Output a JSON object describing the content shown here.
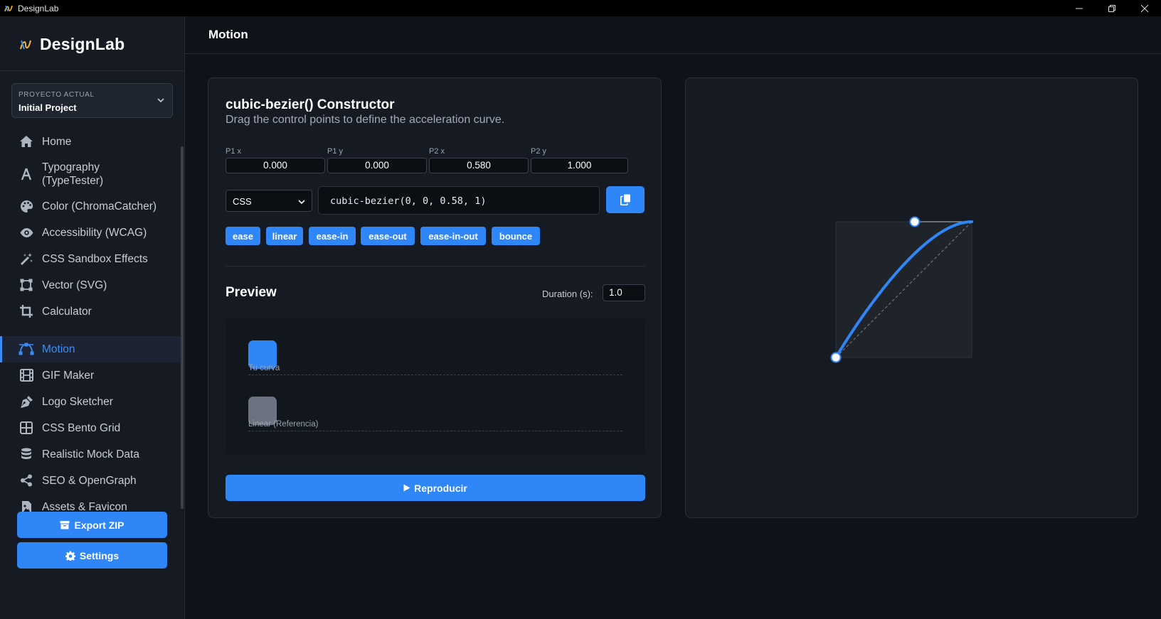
{
  "window": {
    "title": "DesignLab",
    "controls": [
      "minimize-icon",
      "restore-icon",
      "close-icon"
    ]
  },
  "sidebar": {
    "brand": "DesignLab",
    "project": {
      "label": "PROYECTO ACTUAL",
      "value": "Initial Project"
    },
    "items": [
      {
        "label": "Home",
        "icon": "home-icon"
      },
      {
        "label": "Typography\n(TypeTester)",
        "icon": "typography-icon"
      },
      {
        "label": "Color (ChromaCatcher)",
        "icon": "palette-icon"
      },
      {
        "label": "Accessibility (WCAG)",
        "icon": "eye-icon"
      },
      {
        "label": "CSS Sandbox Effects",
        "icon": "magic-wand-icon"
      },
      {
        "label": "Vector (SVG)",
        "icon": "vector-square-icon"
      },
      {
        "label": "Calculator",
        "icon": "crop-icon"
      },
      {
        "label": "Motion",
        "icon": "bezier-curve-icon",
        "active": true
      },
      {
        "label": "GIF Maker",
        "icon": "film-icon"
      },
      {
        "label": "Logo Sketcher",
        "icon": "pen-nib-icon"
      },
      {
        "label": "CSS Bento Grid",
        "icon": "grid-icon"
      },
      {
        "label": "Realistic Mock Data",
        "icon": "database-icon"
      },
      {
        "label": "SEO & OpenGraph",
        "icon": "share-icon"
      },
      {
        "label": "Assets & Favicon",
        "icon": "file-image-icon"
      }
    ],
    "export_label": "Export ZIP",
    "settings_label": "Settings"
  },
  "header": {
    "title": "Motion"
  },
  "constructor": {
    "title": "cubic-bezier() Constructor",
    "subtitle": "Drag the control points to define the acceleration curve.",
    "coords": [
      {
        "label": "P1 x",
        "value": "0.000"
      },
      {
        "label": "P1 y",
        "value": "0.000"
      },
      {
        "label": "P2 x",
        "value": "0.580"
      },
      {
        "label": "P2 y",
        "value": "1.000"
      }
    ],
    "format": {
      "selected": "CSS"
    },
    "code": "cubic-bezier(0, 0, 0.58, 1)",
    "presets": [
      "ease",
      "linear",
      "ease-in",
      "ease-out",
      "ease-in-out",
      "bounce"
    ]
  },
  "preview": {
    "title": "Preview",
    "duration_label": "Duration (s):",
    "duration_value": "1.0",
    "tracks": [
      {
        "label": "Tu curva"
      },
      {
        "label": "Linear (Referencia)"
      }
    ],
    "play_label": "Reproducir"
  },
  "bezier": {
    "p1": [
      0.0,
      0.0
    ],
    "p2": [
      0.58,
      1.0
    ]
  },
  "colors": {
    "accent": "#2f86f6",
    "start_point": "#e5484d",
    "background": "#0f1218",
    "panel": "#161b23"
  }
}
